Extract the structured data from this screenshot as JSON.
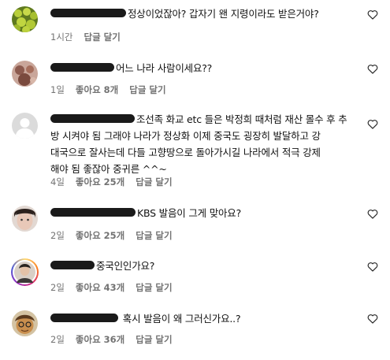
{
  "comments": [
    {
      "text": "정상이었잖아? 갑자기 왠 지령이라도 받은거야?",
      "time": "1시간",
      "likes": "",
      "reply": "답글 달기"
    },
    {
      "text": "어느 나라 사람이세요??",
      "time": "1일",
      "likes": "좋아요 8개",
      "reply": "답글 달기"
    },
    {
      "text_line1": "조선족 화교 etc 들은 박정희 때처럼 재산 몰수 후 추",
      "text_line2": "방 시켜야 됨 그래야 나라가 정상화 이제 중국도 굉장히 발달하고 강",
      "text_line3": "대국으로 잘사는데 다들 고향땅으로 돌아가시길 나라에서 적극 강제",
      "text_line4": "해야 됨 좋잖아 중귀른 ^^~",
      "time": "4일",
      "likes": "좋아요 25개",
      "reply": "답글 달기"
    },
    {
      "text": "KBS 발음이 그게 맞아요?",
      "time": "2일",
      "likes": "좋아요 25개",
      "reply": "답글 달기"
    },
    {
      "text": "중국인인가요?",
      "time": "2일",
      "likes": "좋아요 43개",
      "reply": "답글 달기"
    },
    {
      "text": "혹시 발음이 왜 그러신가요..?",
      "time": "2일",
      "likes": "좋아요 36개",
      "reply": "답글 달기"
    }
  ]
}
